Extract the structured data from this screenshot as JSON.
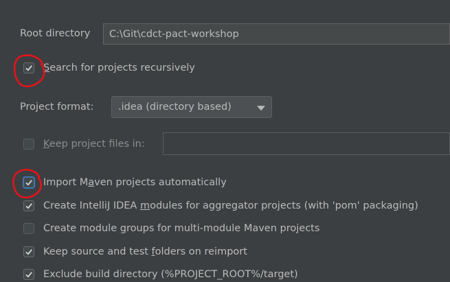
{
  "root_directory": {
    "label": "Root directory",
    "value": "C:\\Git\\cdct-pact-workshop"
  },
  "search_recursively": {
    "label_first": "S",
    "label_rest": "earch for projects recursively",
    "checked": true
  },
  "project_format": {
    "label": "Project format:",
    "selected": ".idea (directory based)"
  },
  "keep_project_files": {
    "label_first": "K",
    "label_rest": "eep project files in:",
    "checked": false,
    "value": ""
  },
  "maven_options": [
    {
      "pre": "Import M",
      "u": "a",
      "post": "ven projects automatically",
      "checked": true
    },
    {
      "pre": "Create IntelliJ IDEA ",
      "u": "m",
      "post": "odules for aggregator projects (with 'pom' packaging)",
      "checked": true
    },
    {
      "pre": "Create module ",
      "u": "g",
      "post": "roups for multi-module Maven projects",
      "checked": false
    },
    {
      "pre": "Keep source and test ",
      "u": "f",
      "post": "olders on reimport",
      "checked": true
    },
    {
      "pre": "Exclude build directory (%PROJECT_ROOT%/target)",
      "u": "",
      "post": "",
      "checked": true
    }
  ],
  "colors": {
    "annotation": "#e8121b",
    "focus": "#3d77b5",
    "background": "#3c3f41"
  }
}
